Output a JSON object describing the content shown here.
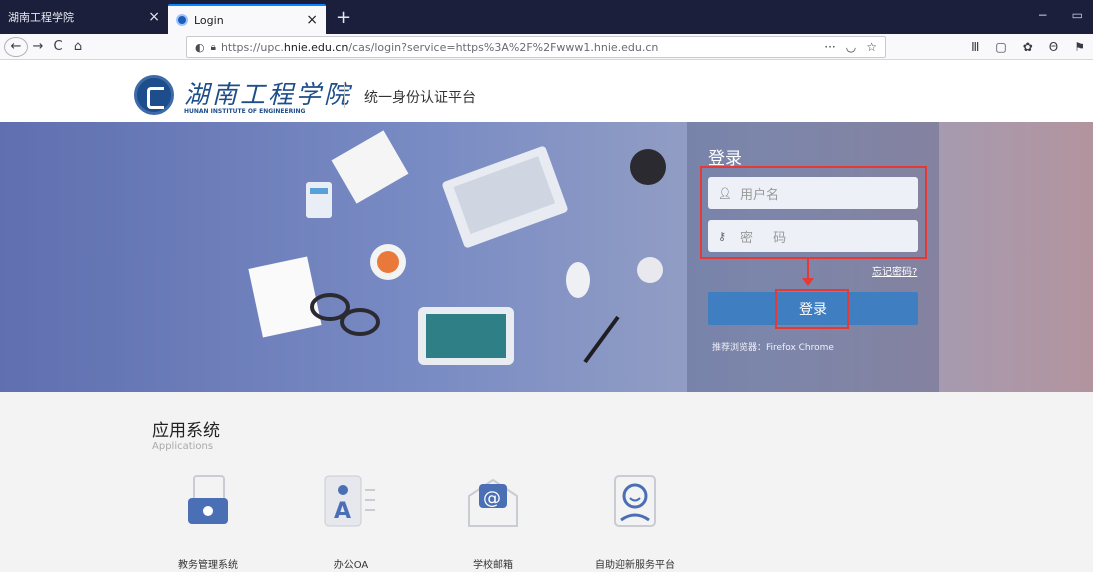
{
  "browser": {
    "tabs": [
      {
        "title": "湖南工程学院",
        "active": false
      },
      {
        "title": "Login",
        "active": true
      }
    ],
    "new_tab_label": "+",
    "url_prefix": "https://upc.",
    "url_host": "hnie.edu.cn",
    "url_rest": "/cas/login?service=https%3A%2F%2Fwww1.hnie.edu.cn",
    "url_more": "···",
    "nav": {
      "back": "←",
      "forward": "→",
      "reload": "C",
      "home": "⌂"
    },
    "window_controls": {
      "minimize": "−",
      "restore": "▭"
    }
  },
  "header": {
    "school_name_cn": "湖南工程学院",
    "school_name_en": "HUNAN INSTITUTE OF ENGINEERING",
    "platform_title": "统一身份认证平台"
  },
  "login": {
    "title": "登录",
    "username_placeholder": "用户名",
    "password_placeholder": "密 码",
    "forgot_password": "忘记密码?",
    "submit_label": "登录",
    "browser_tip": "推荐浏览器：Firefox Chrome"
  },
  "apps": {
    "title": "应用系统",
    "subtitle": "Applications",
    "items": [
      {
        "label": "教务管理系统",
        "icon": "academic-system-icon"
      },
      {
        "label": "办公OA",
        "icon": "office-oa-icon"
      },
      {
        "label": "学校邮箱",
        "icon": "school-mail-icon"
      },
      {
        "label": "自助迎新服务平台",
        "icon": "freshman-service-icon"
      }
    ]
  },
  "colors": {
    "accent": "#3f7ec1",
    "highlight": "#e53935",
    "tabbar": "#1b1f3b"
  }
}
